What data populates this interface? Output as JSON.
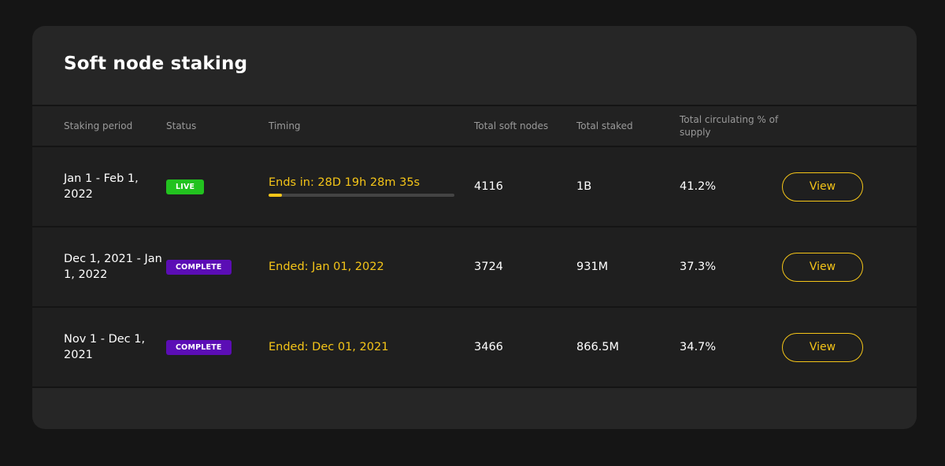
{
  "title": "Soft node staking",
  "columns": {
    "period": "Staking period",
    "status": "Status",
    "timing": "Timing",
    "nodes": "Total soft nodes",
    "staked": "Total staked",
    "circulating": "Total circulating % of supply"
  },
  "colors": {
    "accent": "#f5c518",
    "live": "#22c21f",
    "complete": "#5b0db5"
  },
  "rows": [
    {
      "period": "Jan 1 - Feb 1, 2022",
      "status": "LIVE",
      "timing": "Ends in: 28D 19h 28m 35s",
      "progress": 0.07,
      "nodes": "4116",
      "staked": "1B",
      "circulating": "41.2%",
      "action": "View"
    },
    {
      "period": "Dec 1, 2021 - Jan 1, 2022",
      "status": "COMPLETE",
      "timing": "Ended: Jan 01, 2022",
      "nodes": "3724",
      "staked": "931M",
      "circulating": "37.3%",
      "action": "View"
    },
    {
      "period": "Nov 1 - Dec 1, 2021",
      "status": "COMPLETE",
      "timing": "Ended: Dec 01, 2021",
      "nodes": "3466",
      "staked": "866.5M",
      "circulating": "34.7%",
      "action": "View"
    }
  ]
}
